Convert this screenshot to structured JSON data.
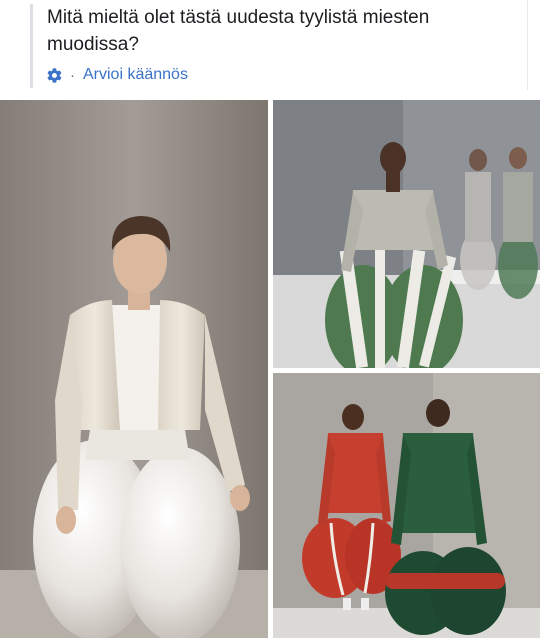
{
  "post": {
    "text": "Mitä mieltä olet tästä uudesta tyylistä miesten muodissa?",
    "translation_action": "Arvioi käännös",
    "separator": "·",
    "translation_icon": "gear-icon"
  },
  "photos": [
    {
      "name": "photo-white-balloon-pants-model",
      "subject": "model in cream cropped blazer and glossy white balloon trousers"
    },
    {
      "name": "photo-green-striped-runway",
      "subject": "models in green and white striped balloon trousers"
    },
    {
      "name": "photo-red-green-back-view",
      "subject": "two models from behind in red and green balloon outfits"
    }
  ],
  "colors": {
    "link": "#3a72c9",
    "text": "#1c1e21",
    "quote_bar": "#dcdfe4"
  }
}
